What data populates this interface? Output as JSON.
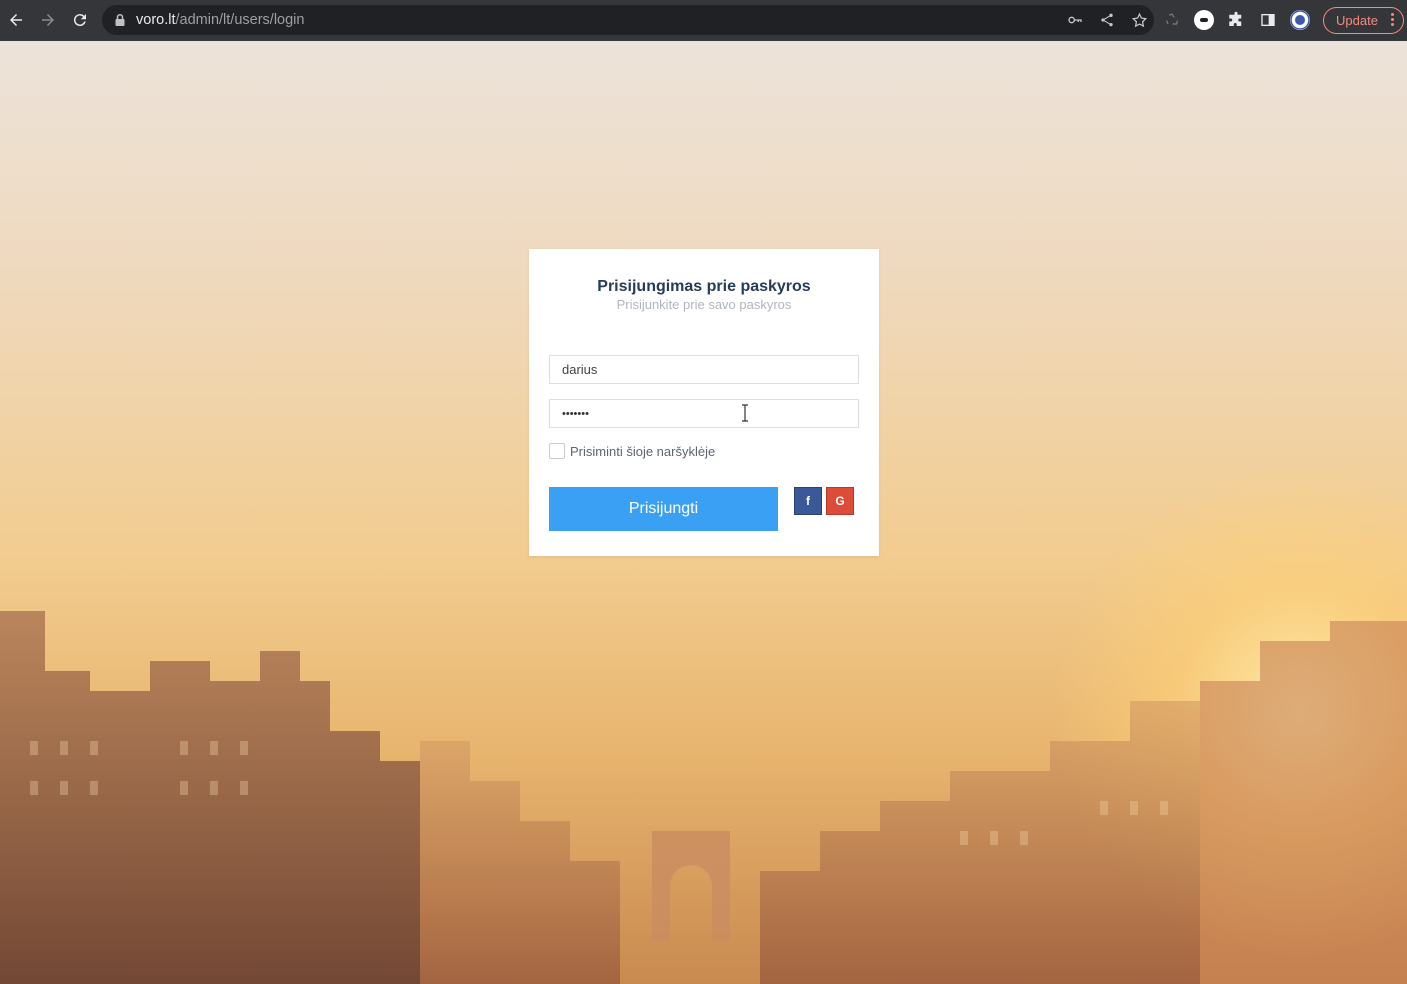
{
  "browser": {
    "url_host": "voro.lt",
    "url_path": "/admin/lt/users/login",
    "update_label": "Update"
  },
  "login": {
    "title": "Prisijungimas prie paskyros",
    "subtitle": "Prisijunkite prie savo paskyros",
    "username_value": "darius",
    "password_value": "•••••••",
    "remember_label": "Prisiminti šioje naršyklėje",
    "remember_checked": false,
    "submit_label": "Prisijungti",
    "facebook_icon_label": "f",
    "google_icon_label": "G"
  },
  "colors": {
    "primary_button": "#3aa0f3",
    "facebook": "#3b5998",
    "google": "#dd4b39",
    "title": "#263d5a"
  }
}
